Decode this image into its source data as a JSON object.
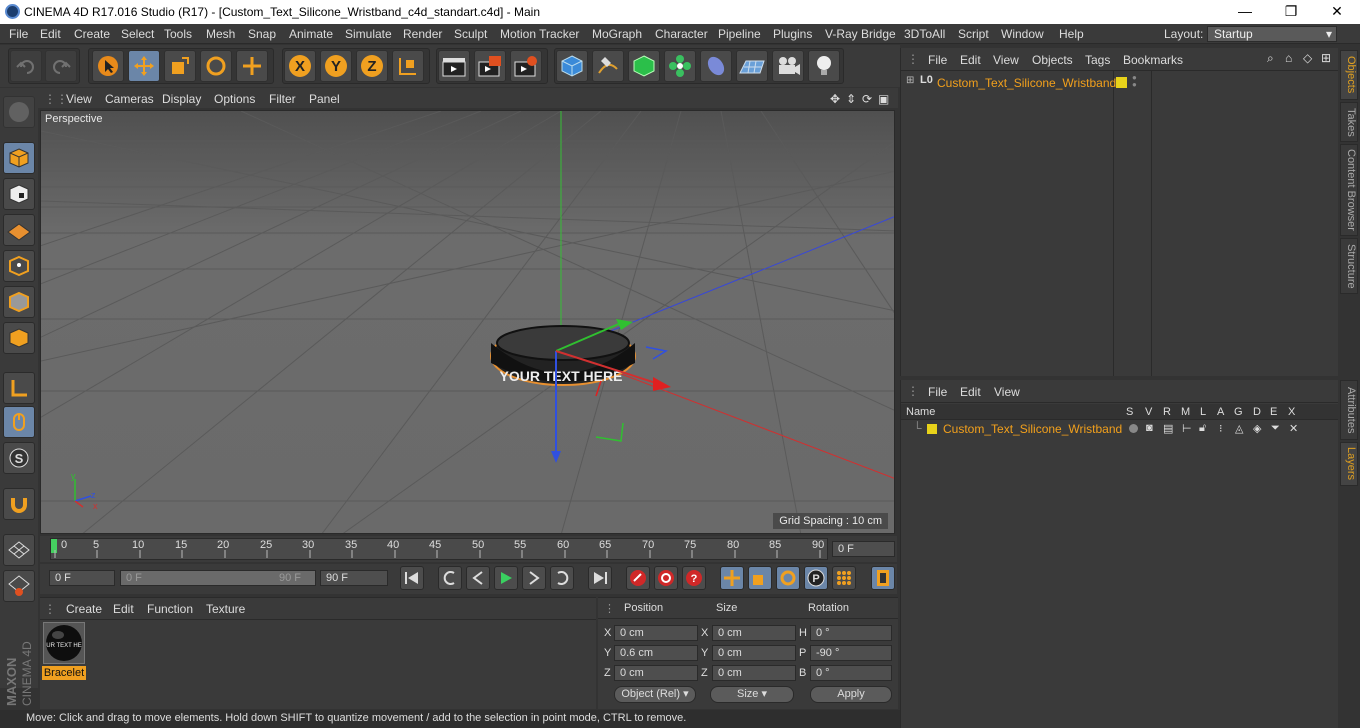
{
  "window": {
    "title": "CINEMA 4D R17.016 Studio (R17) - [Custom_Text_Silicone_Wristband_c4d_standart.c4d] - Main",
    "minimize": "—",
    "maximize": "❐",
    "close": "✕"
  },
  "menu": [
    "File",
    "Edit",
    "Create",
    "Select",
    "Tools",
    "Mesh",
    "Snap",
    "Animate",
    "Simulate",
    "Render",
    "Sculpt",
    "Motion Tracker",
    "MoGraph",
    "Character",
    "Pipeline",
    "Plugins",
    "V-Ray Bridge",
    "3DToAll",
    "Script",
    "Window",
    "Help"
  ],
  "layout": {
    "label": "Layout:",
    "value": "Startup"
  },
  "viewport": {
    "menu": [
      "View",
      "Cameras",
      "Display",
      "Options",
      "Filter",
      "Panel"
    ],
    "label": "Perspective",
    "grid_spacing": "Grid Spacing : 10 cm",
    "wristband_text": "YOUR TEXT HERE"
  },
  "timeline": {
    "ticks": [
      "0",
      "5",
      "10",
      "15",
      "20",
      "25",
      "30",
      "35",
      "40",
      "45",
      "50",
      "55",
      "60",
      "65",
      "70",
      "75",
      "80",
      "85",
      "90"
    ],
    "current": "0 F",
    "start": "0 F",
    "range_start": "0 F",
    "range_end": "90 F",
    "end": "90 F"
  },
  "material": {
    "menu": [
      "Create",
      "Edit",
      "Function",
      "Texture"
    ],
    "name": "Bracelet",
    "thumb_text": "UR TEXT HE"
  },
  "coords": {
    "headers": {
      "position": "Position",
      "size": "Size",
      "rotation": "Rotation"
    },
    "rows": [
      {
        "axis": "X",
        "pos": "0 cm",
        "saxis": "X",
        "size": "0 cm",
        "raxis": "H",
        "rot": "0 °"
      },
      {
        "axis": "Y",
        "pos": "0.6 cm",
        "saxis": "Y",
        "size": "0 cm",
        "raxis": "P",
        "rot": "-90 °"
      },
      {
        "axis": "Z",
        "pos": "0 cm",
        "saxis": "Z",
        "size": "0 cm",
        "raxis": "B",
        "rot": "0 °"
      }
    ],
    "mode": "Object (Rel)",
    "size_mode": "Size",
    "apply": "Apply"
  },
  "status": "Move: Click and drag to move elements. Hold down SHIFT to quantize movement / add to the selection in point mode, CTRL to remove.",
  "objects": {
    "menu": [
      "File",
      "Edit",
      "View",
      "Objects",
      "Tags",
      "Bookmarks"
    ],
    "item": "Custom_Text_Silicone_Wristband"
  },
  "layers": {
    "menu": [
      "File",
      "Edit",
      "View"
    ],
    "name_header": "Name",
    "flags": [
      "S",
      "V",
      "R",
      "M",
      "L",
      "A",
      "G",
      "D",
      "E",
      "X"
    ],
    "item": "Custom_Text_Silicone_Wristband"
  },
  "right_tabs": [
    "Objects",
    "Takes",
    "Content Browser",
    "Structure",
    "Attributes",
    "Layers"
  ],
  "colors": {
    "accent": "#f2a01c",
    "layer": "#e8d21a",
    "axis_x": "#e03030",
    "axis_y": "#30c030",
    "axis_z": "#3050e0"
  }
}
